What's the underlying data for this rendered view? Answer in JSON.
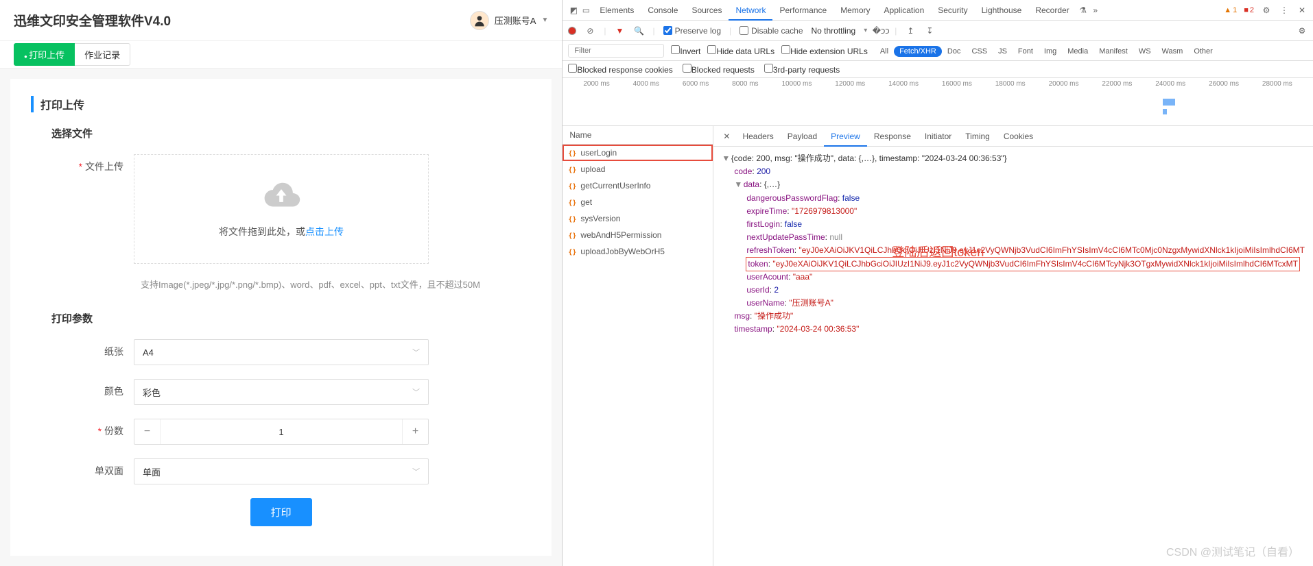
{
  "app": {
    "title": "迅维文印安全管理软件V4.0",
    "userName": "压测账号A",
    "tabs": [
      {
        "label": "打印上传",
        "active": true
      },
      {
        "label": "作业记录",
        "active": false
      }
    ]
  },
  "form": {
    "sectionTitle": "打印上传",
    "chooseFile": "选择文件",
    "uploadLabel": "文件上传",
    "uploadText": "将文件拖到此处，或",
    "uploadLink": "点击上传",
    "uploadHint": "支持Image(*.jpeg/*.jpg/*.png/*.bmp)、word、pdf、excel、ppt、txt文件，且不超过50M",
    "paramsTitle": "打印参数",
    "paper": {
      "label": "纸张",
      "value": "A4"
    },
    "color": {
      "label": "颜色",
      "value": "彩色"
    },
    "copies": {
      "label": "份数",
      "value": "1"
    },
    "duplex": {
      "label": "单双面",
      "value": "单面"
    },
    "submit": "打印"
  },
  "devtools": {
    "tabs": [
      "Elements",
      "Console",
      "Sources",
      "Network",
      "Performance",
      "Memory",
      "Application",
      "Security",
      "Lighthouse",
      "Recorder"
    ],
    "activeTab": "Network",
    "warnCount": "1",
    "errCount": "2",
    "toolbar": {
      "preserveLog": "Preserve log",
      "disableCache": "Disable cache",
      "throttling": "No throttling"
    },
    "filter": {
      "placeholder": "Filter",
      "invert": "Invert",
      "hideData": "Hide data URLs",
      "hideExt": "Hide extension URLs",
      "types": [
        "All",
        "Fetch/XHR",
        "Doc",
        "CSS",
        "JS",
        "Font",
        "Img",
        "Media",
        "Manifest",
        "WS",
        "Wasm",
        "Other"
      ],
      "activeType": "Fetch/XHR",
      "blockedCookies": "Blocked response cookies",
      "blockedReq": "Blocked requests",
      "thirdParty": "3rd-party requests"
    },
    "timeline": [
      "2000 ms",
      "4000 ms",
      "6000 ms",
      "8000 ms",
      "10000 ms",
      "12000 ms",
      "14000 ms",
      "16000 ms",
      "18000 ms",
      "20000 ms",
      "22000 ms",
      "24000 ms",
      "26000 ms",
      "28000 ms"
    ],
    "reqHead": "Name",
    "requests": [
      "userLogin",
      "upload",
      "getCurrentUserInfo",
      "get",
      "sysVersion",
      "webAndH5Permission",
      "uploadJobByWebOrH5"
    ],
    "selectedReq": "userLogin",
    "detailTabs": [
      "Headers",
      "Payload",
      "Preview",
      "Response",
      "Initiator",
      "Timing",
      "Cookies"
    ],
    "activeDetail": "Preview",
    "response": {
      "summary": "{code: 200, msg: \"操作成功\", data: {,…}, timestamp: \"2024-03-24 00:36:53\"}",
      "code": "200",
      "dataSummary": "{,…}",
      "dangerousPasswordFlag": "false",
      "expireTime": "\"1726979813000\"",
      "firstLogin": "false",
      "nextUpdatePassTime": "null",
      "refreshToken": "\"eyJ0eXAiOiJKV1QiLCJhbGciOiJIUzI1NiJ9.eyJ1c2VyQWNjb3VudCI6ImFhYSIsImV4cCI6MTc0Mjc0NzgxMywidXNlck1kIjoiMiIsImlhdCI6MT",
      "token": "\"eyJ0eXAiOiJKV1QiLCJhbGciOiJIUzI1NiJ9.eyJ1c2VyQWNjb3VudCI6ImFhYSIsImV4cCI6MTcyNjk3OTgxMywidXNlck1kIjoiMiIsImlhdCI6MTcxMT",
      "userAcount": "\"aaa\"",
      "userId": "2",
      "userName": "\"压测账号A\"",
      "msg": "\"操作成功\"",
      "timestamp": "\"2024-03-24 00:36:53\""
    },
    "annotation": "登陆后返回token",
    "watermark": "CSDN @测试笔记（自看）"
  }
}
